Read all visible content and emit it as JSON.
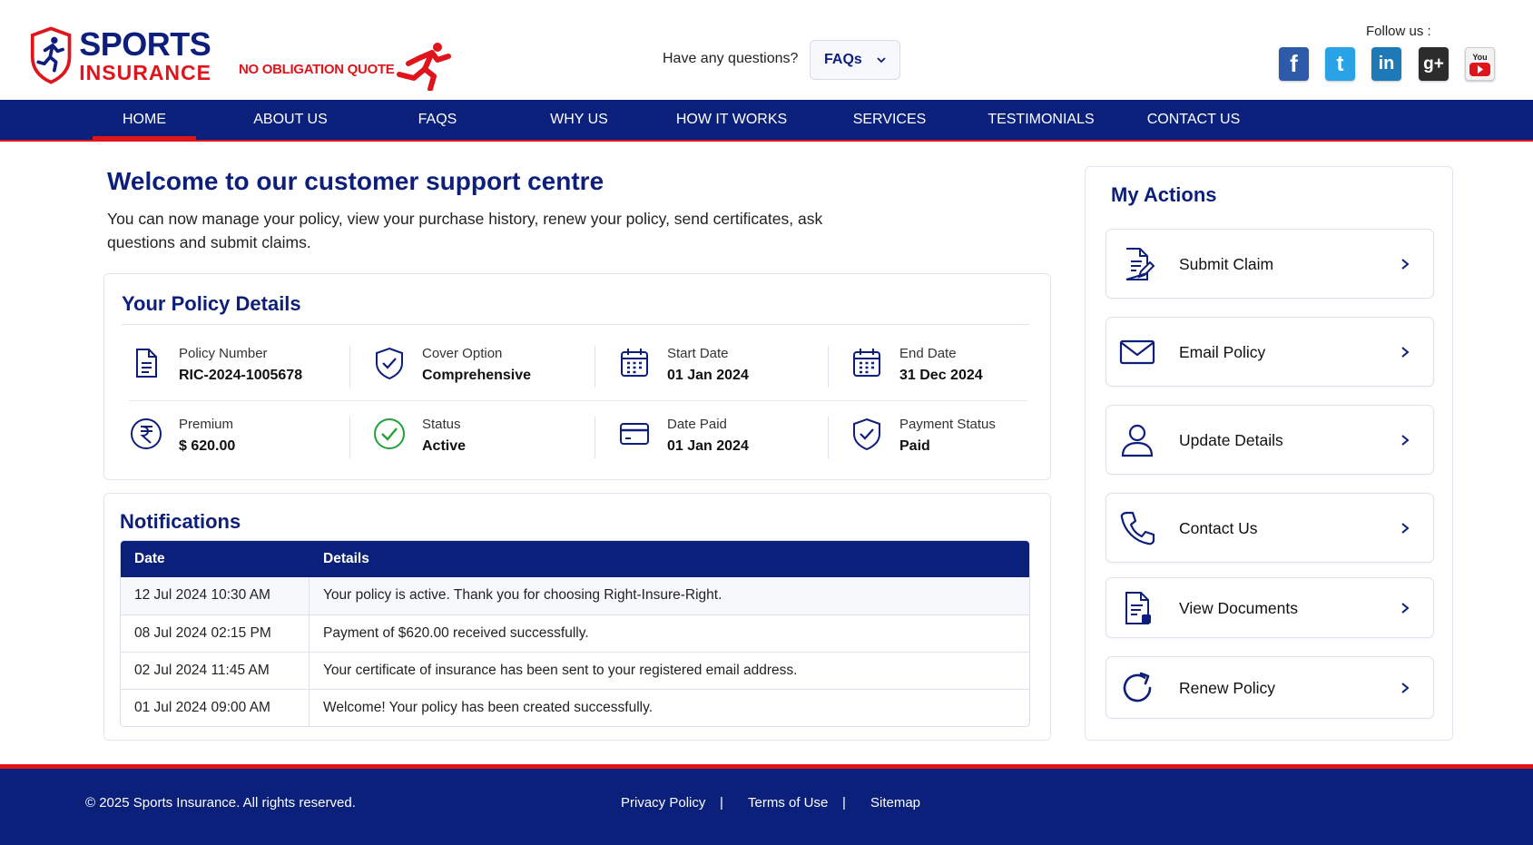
{
  "brand": {
    "line1": "SPORTS",
    "line2": "INSURANCE",
    "quote": "NO OBLIGATION QUOTE"
  },
  "header": {
    "question": "Have any questions?",
    "faq_select": "FAQs",
    "follow": "Follow us :",
    "social": [
      {
        "name": "facebook",
        "glyph": "f"
      },
      {
        "name": "twitter",
        "glyph": "t"
      },
      {
        "name": "linkedin",
        "glyph": "in"
      },
      {
        "name": "google-plus",
        "glyph": "g+"
      },
      {
        "name": "youtube",
        "glyph": "You"
      }
    ]
  },
  "nav": {
    "items": [
      "HOME",
      "ABOUT US",
      "FAQS",
      "WHY US",
      "HOW IT WORKS",
      "SERVICES",
      "TESTIMONIALS",
      "CONTACT US"
    ],
    "active": "HOME"
  },
  "welcome": {
    "title": "Welcome to our customer support centre",
    "text": "You can now manage your policy, view your purchase history, renew your policy, send certificates, ask questions and submit claims."
  },
  "policy": {
    "title": "Your Policy Details",
    "fields": [
      {
        "label": "Policy Number",
        "value": "RIC-2024-1005678",
        "icon": "document-icon"
      },
      {
        "label": "Cover Option",
        "value": "Comprehensive",
        "icon": "shield-check-icon"
      },
      {
        "label": "Start Date",
        "value": "01 Jan 2024",
        "icon": "calendar-icon"
      },
      {
        "label": "End Date",
        "value": "31 Dec 2024",
        "icon": "calendar-icon"
      },
      {
        "label": "Premium",
        "value": "$ 620.00",
        "icon": "rupee-icon"
      },
      {
        "label": "Status",
        "value": "Active",
        "icon": "check-circle-icon"
      },
      {
        "label": "Date Paid",
        "value": "01 Jan 2024",
        "icon": "card-icon"
      },
      {
        "label": "Payment Status",
        "value": "Paid",
        "icon": "shield-check-icon"
      }
    ]
  },
  "notifications": {
    "title": "Notifications",
    "columns": [
      "Date",
      "Details"
    ],
    "rows": [
      [
        "12 Jul 2024 10:30 AM",
        "Your policy is active. Thank you for choosing Right-Insure-Right."
      ],
      [
        "08 Jul 2024 02:15 PM",
        "Payment of $620.00 received successfully."
      ],
      [
        "02 Jul 2024 11:45 AM",
        "Your certificate of insurance has been sent to your registered email address."
      ],
      [
        "01 Jul 2024 09:00 AM",
        "Welcome! Your policy has been created successfully."
      ]
    ]
  },
  "actions": {
    "title": "My Actions",
    "items": [
      {
        "label": "Submit Claim",
        "icon": "claim-document-icon"
      },
      {
        "label": "Email Policy",
        "icon": "envelope-icon"
      },
      {
        "label": "Update Details",
        "icon": "user-icon"
      },
      {
        "label": "Contact Us",
        "icon": "phone-icon"
      },
      {
        "label": "View Documents",
        "icon": "documents-icon"
      },
      {
        "label": "Renew Policy",
        "icon": "refresh-icon"
      }
    ]
  },
  "footer": {
    "copyright": "© 2025 Sports Insurance. All rights reserved.",
    "links": [
      "Privacy Policy",
      "Terms of Use",
      "Sitemap"
    ],
    "separator": "|"
  },
  "colors": {
    "primary": "#0a207a",
    "accent": "#e0141b",
    "success": "#22a03a"
  }
}
